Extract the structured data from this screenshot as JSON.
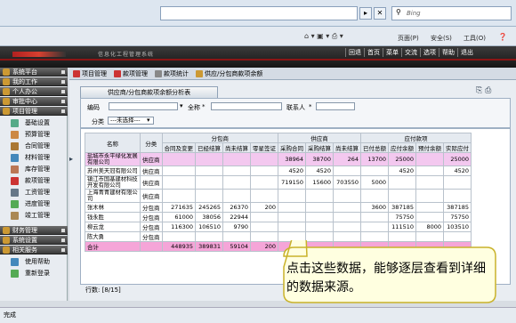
{
  "browser": {
    "search_placeholder": "Bing",
    "toolbar_menus": [
      "页面(P)",
      "安全(S)",
      "工具(O)"
    ]
  },
  "header": {
    "title": "信息化工程管理系统",
    "nav": [
      "回退",
      "首页",
      "菜单",
      "交流",
      "选项",
      "帮助",
      "退出"
    ]
  },
  "sidebar": {
    "groups": [
      {
        "label": "系统平台"
      },
      {
        "label": "我的工作"
      },
      {
        "label": "个人办公"
      },
      {
        "label": "审批中心"
      },
      {
        "label": "项目管理"
      }
    ],
    "items": [
      "基础设置",
      "预算管理",
      "合同管理",
      "材料管理",
      "库存管理",
      "款项管理",
      "工资管理",
      "进度管理",
      "竣工管理"
    ],
    "groups_bottom": [
      {
        "label": "财务管理"
      },
      {
        "label": "系统设置"
      },
      {
        "label": "相关服务"
      }
    ],
    "bottom_items": [
      "使用帮助",
      "重新登录"
    ]
  },
  "content_tabs": [
    "项目管理",
    "款项管理",
    "款项统计",
    "供应/分包商款项余额"
  ],
  "panel": {
    "tab_title": "供应商/分包商款项余额分析表",
    "filter": {
      "code_label": "编码",
      "fullname_label": "全称",
      "required_mark": "*",
      "contact_label": "联系人",
      "category_label": "分类",
      "category_value": "---未选择---"
    },
    "table": {
      "headers_top": [
        "名称",
        "分类",
        "分包商",
        "供应商",
        "应付款项"
      ],
      "headers_sub": [
        "合同及变更",
        "已经结算",
        "尚未结算",
        "零星签证",
        "采购合同",
        "采购结算",
        "尚未结算",
        "已付总额",
        "应付余额",
        "预付余额",
        "实际应付"
      ],
      "rows": [
        {
          "name": "盐城市永平绿化发展有限公司",
          "cat": "供应商",
          "v": [
            "",
            "",
            "",
            "",
            "38964",
            "38700",
            "264",
            "13700",
            "25000",
            "",
            "25000"
          ],
          "hl": true
        },
        {
          "name": "苏州美天冠有限公司",
          "cat": "供应商",
          "v": [
            "",
            "",
            "",
            "",
            "4520",
            "4520",
            "",
            "",
            "4520",
            "",
            "4520"
          ],
          "hl": false
        },
        {
          "name": "镇江市国基建材科技开发有限公司",
          "cat": "供应商",
          "v": [
            "",
            "",
            "",
            "",
            "719150",
            "15600",
            "703550",
            "5000",
            "",
            "",
            ""
          ],
          "hl": false
        },
        {
          "name": "上海青青建材有限公司",
          "cat": "供应商",
          "v": [
            "",
            "",
            "",
            "",
            "",
            "",
            "",
            "",
            "",
            "",
            ""
          ],
          "hl": false
        },
        {
          "name": "张木林",
          "cat": "分包商",
          "v": [
            "271635",
            "245265",
            "26370",
            "200",
            "",
            "",
            "",
            "3600",
            "387185",
            "",
            "387185"
          ],
          "hl": false
        },
        {
          "name": "钱永胜",
          "cat": "分包商",
          "v": [
            "61000",
            "38056",
            "22944",
            "",
            "",
            "",
            "",
            "",
            "75750",
            "",
            "75750"
          ],
          "hl": false
        },
        {
          "name": "柳云龙",
          "cat": "分包商",
          "v": [
            "116300",
            "106510",
            "9790",
            "",
            "",
            "",
            "",
            "",
            "111510",
            "8000",
            "103510"
          ],
          "hl": false
        },
        {
          "name": "陈大勇",
          "cat": "分包商",
          "v": [
            "",
            "",
            "",
            "",
            "",
            "",
            "",
            "",
            "",
            "",
            ""
          ],
          "hl": false
        }
      ],
      "total": {
        "name": "合计",
        "v": [
          "448935",
          "389831",
          "59104",
          "200",
          "",
          "",
          "",
          "",
          "",
          "",
          ""
        ]
      }
    },
    "row_count": "行数: [8/15]"
  },
  "callout": {
    "text": "点击这些数据，能够逐层查看到详细的数据来源。"
  },
  "status_bar": {
    "text": "完成"
  }
}
